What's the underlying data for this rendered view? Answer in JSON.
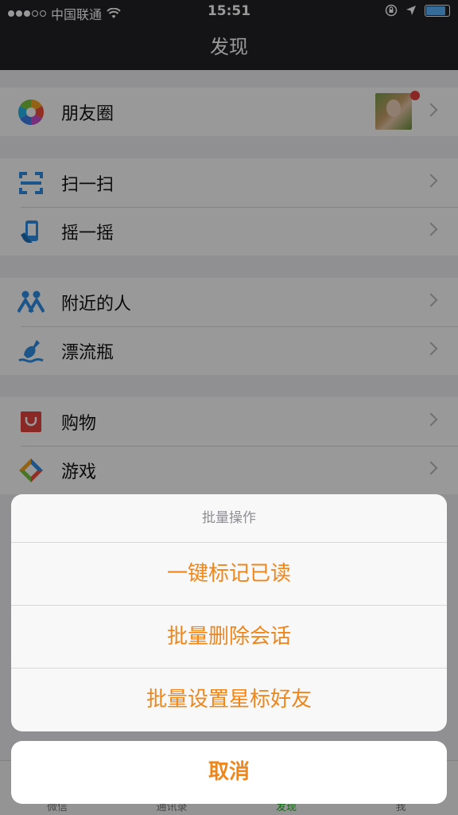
{
  "status_bar": {
    "carrier": "中国联通",
    "time": "15:51"
  },
  "nav": {
    "title": "发现"
  },
  "groups": [
    {
      "items": [
        {
          "label": "朋友圈",
          "icon": "moments-icon"
        }
      ]
    },
    {
      "items": [
        {
          "label": "扫一扫",
          "icon": "scan-icon"
        },
        {
          "label": "摇一摇",
          "icon": "shake-icon"
        }
      ]
    },
    {
      "items": [
        {
          "label": "附近的人",
          "icon": "people-nearby-icon"
        },
        {
          "label": "漂流瓶",
          "icon": "drift-bottle-icon"
        }
      ]
    },
    {
      "items": [
        {
          "label": "购物",
          "icon": "shopping-icon"
        },
        {
          "label": "游戏",
          "icon": "games-icon"
        }
      ]
    }
  ],
  "tabbar": {
    "tabs": [
      "微信",
      "通讯录",
      "发现",
      "我"
    ],
    "active": "发现"
  },
  "action_sheet": {
    "title": "批量操作",
    "options": [
      "一键标记已读",
      "批量删除会话",
      "批量设置星标好友"
    ],
    "cancel": "取消"
  },
  "colors": {
    "accent": "#f08619",
    "nav_bg": "#222226",
    "tab_active": "#1aad19"
  }
}
